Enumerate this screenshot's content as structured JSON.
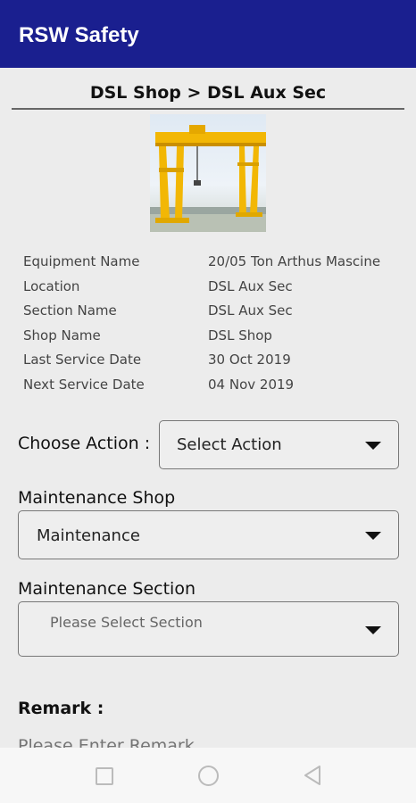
{
  "app": {
    "title": "RSW Safety"
  },
  "breadcrumb": "DSL Shop > DSL Aux Sec",
  "equipment_image": {
    "alt": "Yellow gantry crane"
  },
  "details": [
    {
      "label": "Equipment Name",
      "value": "20/05 Ton Arthus Mascine"
    },
    {
      "label": "Location",
      "value": "DSL Aux Sec"
    },
    {
      "label": "Section Name",
      "value": "DSL Aux Sec"
    },
    {
      "label": "Shop Name",
      "value": "DSL Shop"
    },
    {
      "label": "Last Service Date",
      "value": "30 Oct 2019"
    },
    {
      "label": "Next Service Date",
      "value": "04 Nov 2019"
    }
  ],
  "action": {
    "label": "Choose Action :",
    "selected": "Select Action"
  },
  "maintenance_shop": {
    "label": "Maintenance Shop",
    "selected": "Maintenance"
  },
  "maintenance_section": {
    "label": "Maintenance Section",
    "placeholder": "Please Select Section"
  },
  "remark": {
    "label": "Remark :",
    "placeholder": "Please Enter Remark"
  },
  "icons": {
    "dropdown": "triangle-down-icon",
    "nav_recent": "square-icon",
    "nav_home": "circle-icon",
    "nav_back": "triangle-left-icon"
  },
  "colors": {
    "appbar": "#1a1f8f",
    "background": "#ececec"
  }
}
